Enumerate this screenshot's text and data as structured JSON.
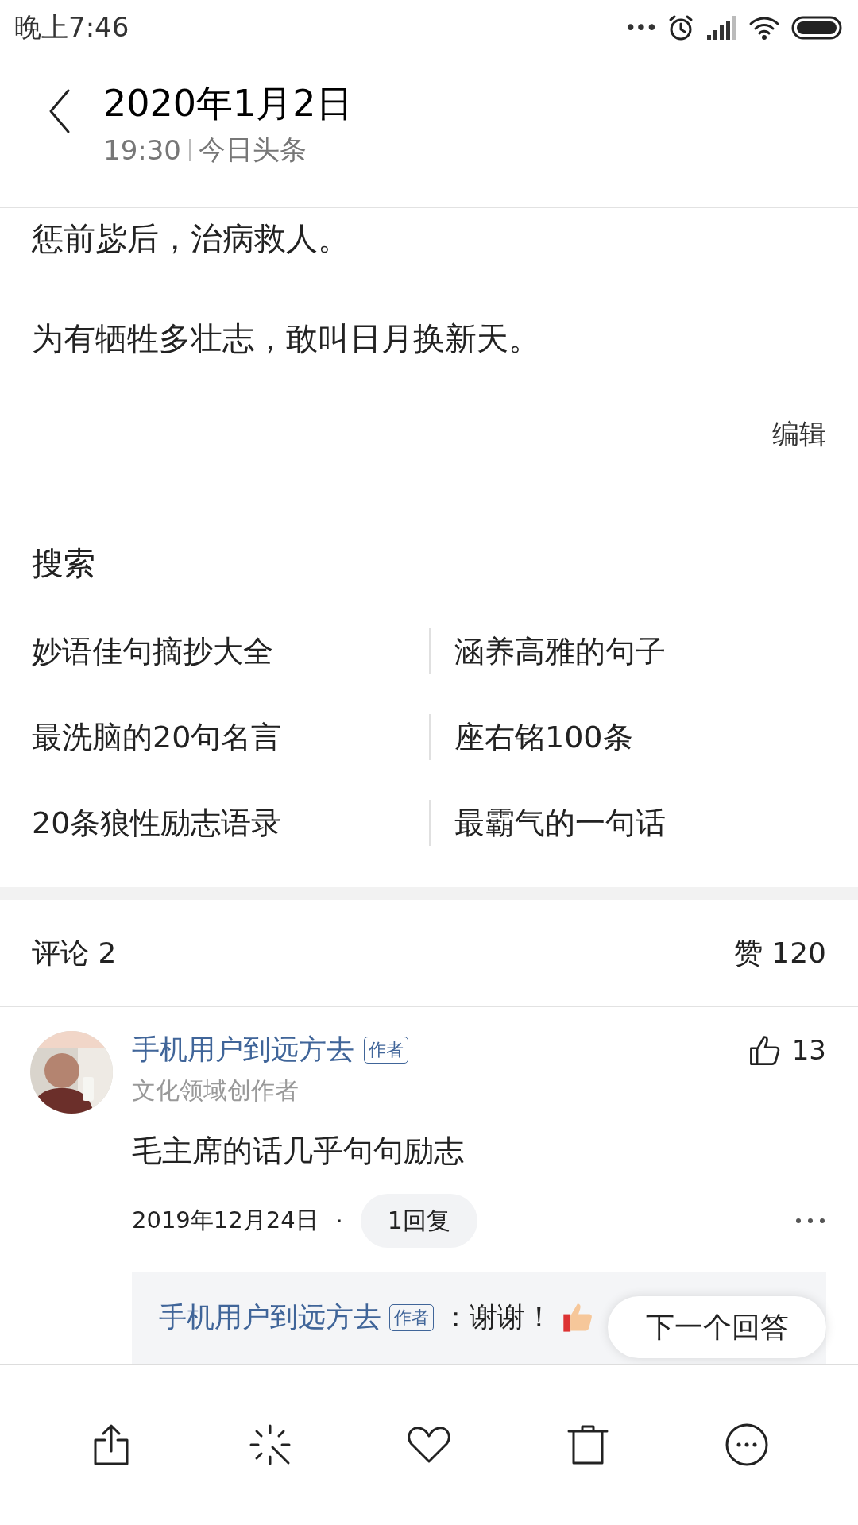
{
  "status_bar": {
    "time": "晚上7:46",
    "dots": "•••"
  },
  "header": {
    "title": "2020年1月2日",
    "time": "19:30",
    "source": "今日头条"
  },
  "article": {
    "paragraphs": [
      "惩前毖后，治病救人。",
      "为有牺牲多壮志，敢叫日月换新天。"
    ],
    "edit_link": "编辑"
  },
  "search": {
    "title": "搜索",
    "items": [
      "妙语佳句摘抄大全",
      "涵养高雅的句子",
      "最洗脑的20句名言",
      "座右铭100条",
      "20条狼性励志语录",
      "最霸气的一句话"
    ]
  },
  "comments_header": {
    "count": "评论 2",
    "likes": "赞 120"
  },
  "comment": {
    "author": "手机用户到远方去",
    "badge": "作者",
    "subtitle": "文化领域创作者",
    "likes": "13",
    "text": "毛主席的话几乎句句励志",
    "date": "2019年12月24日",
    "separator": "·",
    "reply_button": "1回复",
    "reply": {
      "author": "手机用户到远方去",
      "badge": "作者",
      "text": "：谢谢！"
    }
  },
  "next_answer": "下一个回答"
}
